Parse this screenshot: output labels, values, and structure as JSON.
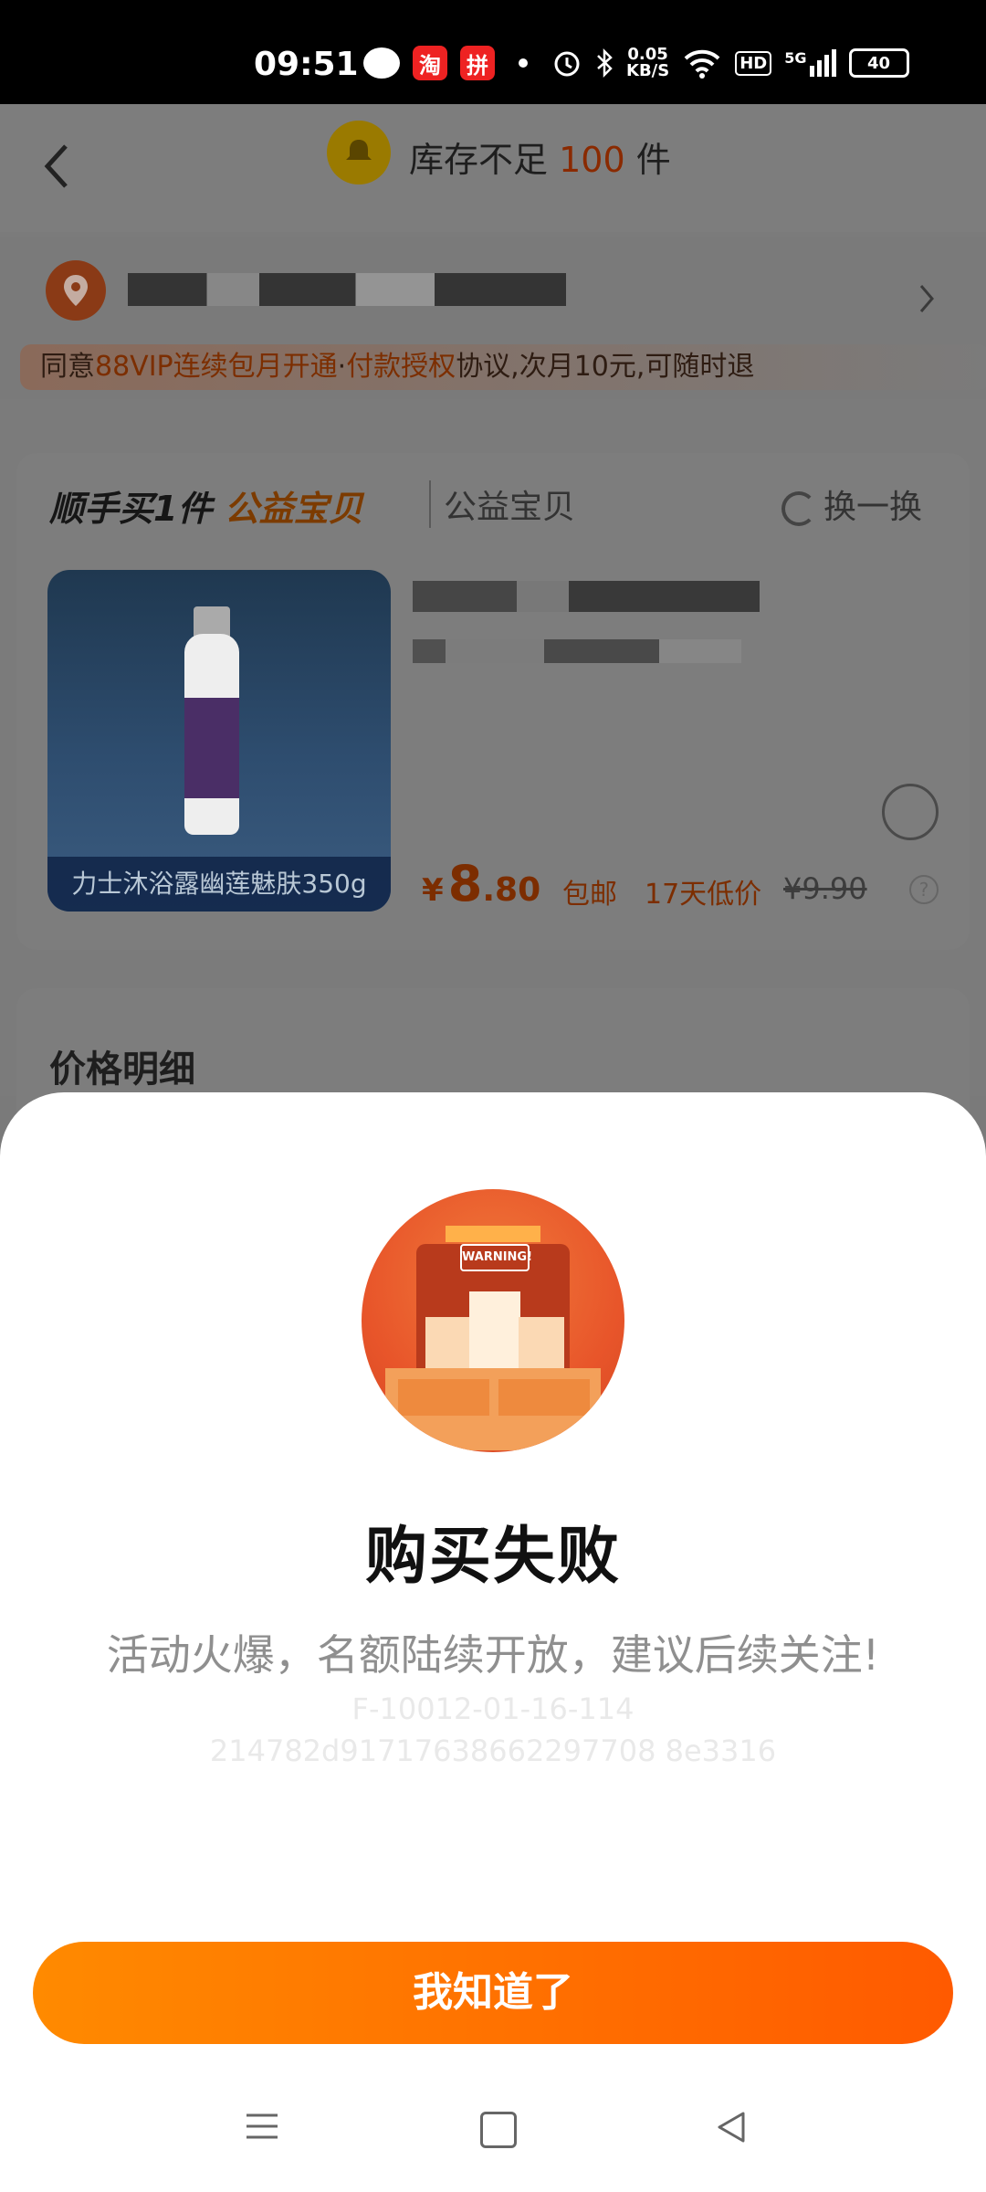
{
  "status_bar": {
    "time": "09:51",
    "app_icon_1": "淘",
    "app_icon_2": "拼",
    "net_speed": "0.05",
    "net_unit": "KB/S",
    "hd": "HD",
    "signal": "5G",
    "battery": "40"
  },
  "header": {
    "title_prefix": "库存不足",
    "stock_count": "100",
    "title_suffix": "件"
  },
  "agreement": {
    "text_before": "同意",
    "link_1": "88VIP连续包月开通",
    "separator": "·",
    "link_2": "付款授权",
    "text_after": "协议,次月10元,可随时退"
  },
  "product_section": {
    "title": "顺手买1件",
    "title_highlight": "公益宝贝",
    "subtitle": "公益宝贝",
    "swap_label": "换一换",
    "image_caption": "力士沐浴露幽莲魅肤350g",
    "price_currency": "¥",
    "price_int": "8",
    "price_dec": ".80",
    "tag_shipping": "包邮",
    "tag_low_price": "17天低价",
    "original_price": "¥9.90",
    "help_label": "?"
  },
  "price_detail": {
    "title": "价格明细"
  },
  "dialog": {
    "title": "购买失败",
    "message": "活动火爆，名额陆续开放，建议后续关注!",
    "code_line_1": "F-10012-01-16-114",
    "code_line_2": "214782d91717638662297708 8e3316",
    "button_label": "我知道了",
    "illustration_text": "WARNING!"
  },
  "colors": {
    "accent_orange": "#ff6a00",
    "button_gradient_start": "#ff8a00",
    "button_gradient_end": "#ff5a00"
  }
}
